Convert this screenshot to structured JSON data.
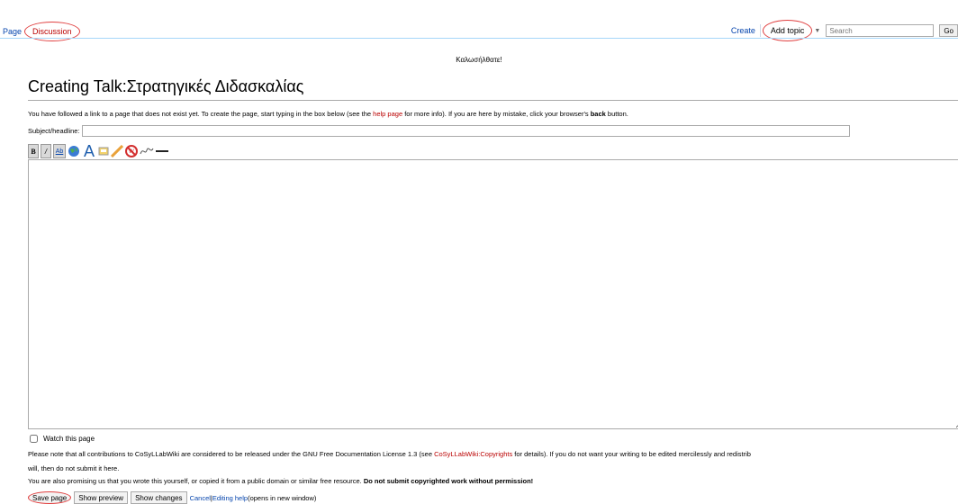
{
  "tabs": {
    "page": "Page",
    "discussion": "Discussion",
    "create": "Create",
    "add_topic": "Add topic",
    "search_placeholder": "Search",
    "go": "Go"
  },
  "sitenotice": "Καλωσήλθατε!",
  "title": "Creating Talk:Στρατηγικές Διδασκαλίας",
  "intro": {
    "part1": "You have followed a link to a page that does not exist yet. To create the page, start typing in the box below (see the ",
    "help_link": "help page",
    "part2": " for more info). If you are here by mistake, click your browser's ",
    "back": "back",
    "part3": " button."
  },
  "subject_label": "Subject/headline:",
  "subject_value": "",
  "toolbar": [
    "bold-icon",
    "italic-icon",
    "internal-link-icon",
    "external-link-icon",
    "headline-icon",
    "image-icon",
    "media-icon",
    "nowiki-icon",
    "signature-icon",
    "horizontal-line-icon"
  ],
  "editor_text": "",
  "watch_label": "Watch this page",
  "license": {
    "part1": "Please note that all contributions to CoSyLLabWiki are considered to be released under the GNU Free Documentation License 1.3 (see ",
    "link": "CoSyLLabWiki:Copyrights",
    "part2": " for details). If you do not want your writing to be edited mercilessly and redistrib",
    "line2": "will, then do not submit it here.",
    "line3a": "You are also promising us that you wrote this yourself, or copied it from a public domain or similar free resource. ",
    "line3b": "Do not submit copyrighted work without permission!"
  },
  "actions": {
    "save": "Save page",
    "preview": "Show preview",
    "changes": "Show changes",
    "cancel": "Cancel",
    "sep": " | ",
    "help": "Editing help",
    "help_note": " (opens in new window)"
  },
  "colors": {
    "link": "#0645ad",
    "redlink": "#ba0000",
    "annotation": "#e04040"
  }
}
